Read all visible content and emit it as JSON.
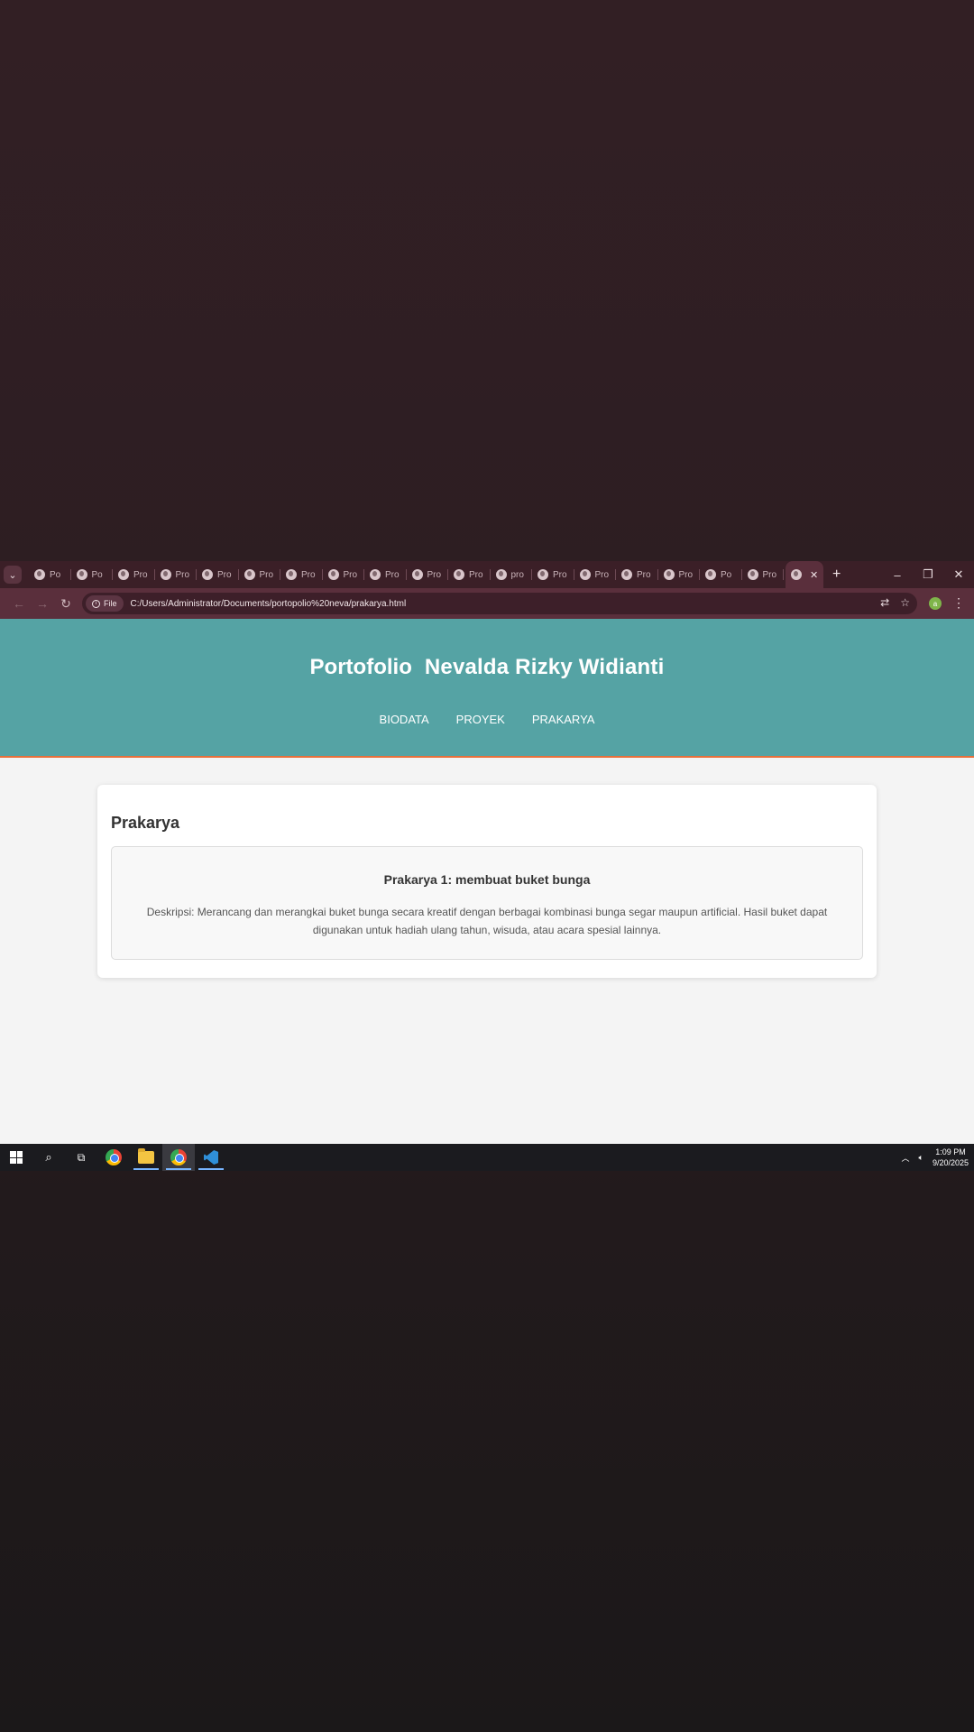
{
  "browser": {
    "tabs": [
      {
        "label": "Po"
      },
      {
        "label": "Po"
      },
      {
        "label": "Pro"
      },
      {
        "label": "Pro"
      },
      {
        "label": "Pro"
      },
      {
        "label": "Pro"
      },
      {
        "label": "Pro"
      },
      {
        "label": "Pro"
      },
      {
        "label": "Pro"
      },
      {
        "label": "Pro"
      },
      {
        "label": "Pro"
      },
      {
        "label": "pro"
      },
      {
        "label": "Pro"
      },
      {
        "label": "Pro"
      },
      {
        "label": "Pro"
      },
      {
        "label": "Pro"
      },
      {
        "label": "Po"
      },
      {
        "label": "Pro"
      }
    ],
    "new_tab": "+",
    "address": {
      "chip": "File",
      "url": "C:/Users/Administrator/Documents/portopolio%20neva/prakarya.html"
    },
    "profile_initial": "a",
    "accent": "#5a2f3c"
  },
  "site": {
    "brand_left": "Portofolio",
    "brand_right": "Nevalda Rizky Widianti",
    "nav": [
      "BIODATA",
      "PROYEK",
      "PRAKARYA"
    ],
    "header_color": "#55a3a4",
    "header_border_color": "#e8703a"
  },
  "content": {
    "section_title": "Prakarya",
    "item": {
      "title": "Prakarya 1: membuat buket bunga",
      "description": "Deskripsi: Merancang dan merangkai buket bunga secara kreatif dengan berbagai kombinasi bunga segar maupun artificial. Hasil buket dapat digunakan untuk hadiah ulang tahun, wisuda, atau acara spesial lainnya."
    }
  },
  "taskbar": {
    "time": "1:09 PM",
    "date": "9/20/2025"
  }
}
